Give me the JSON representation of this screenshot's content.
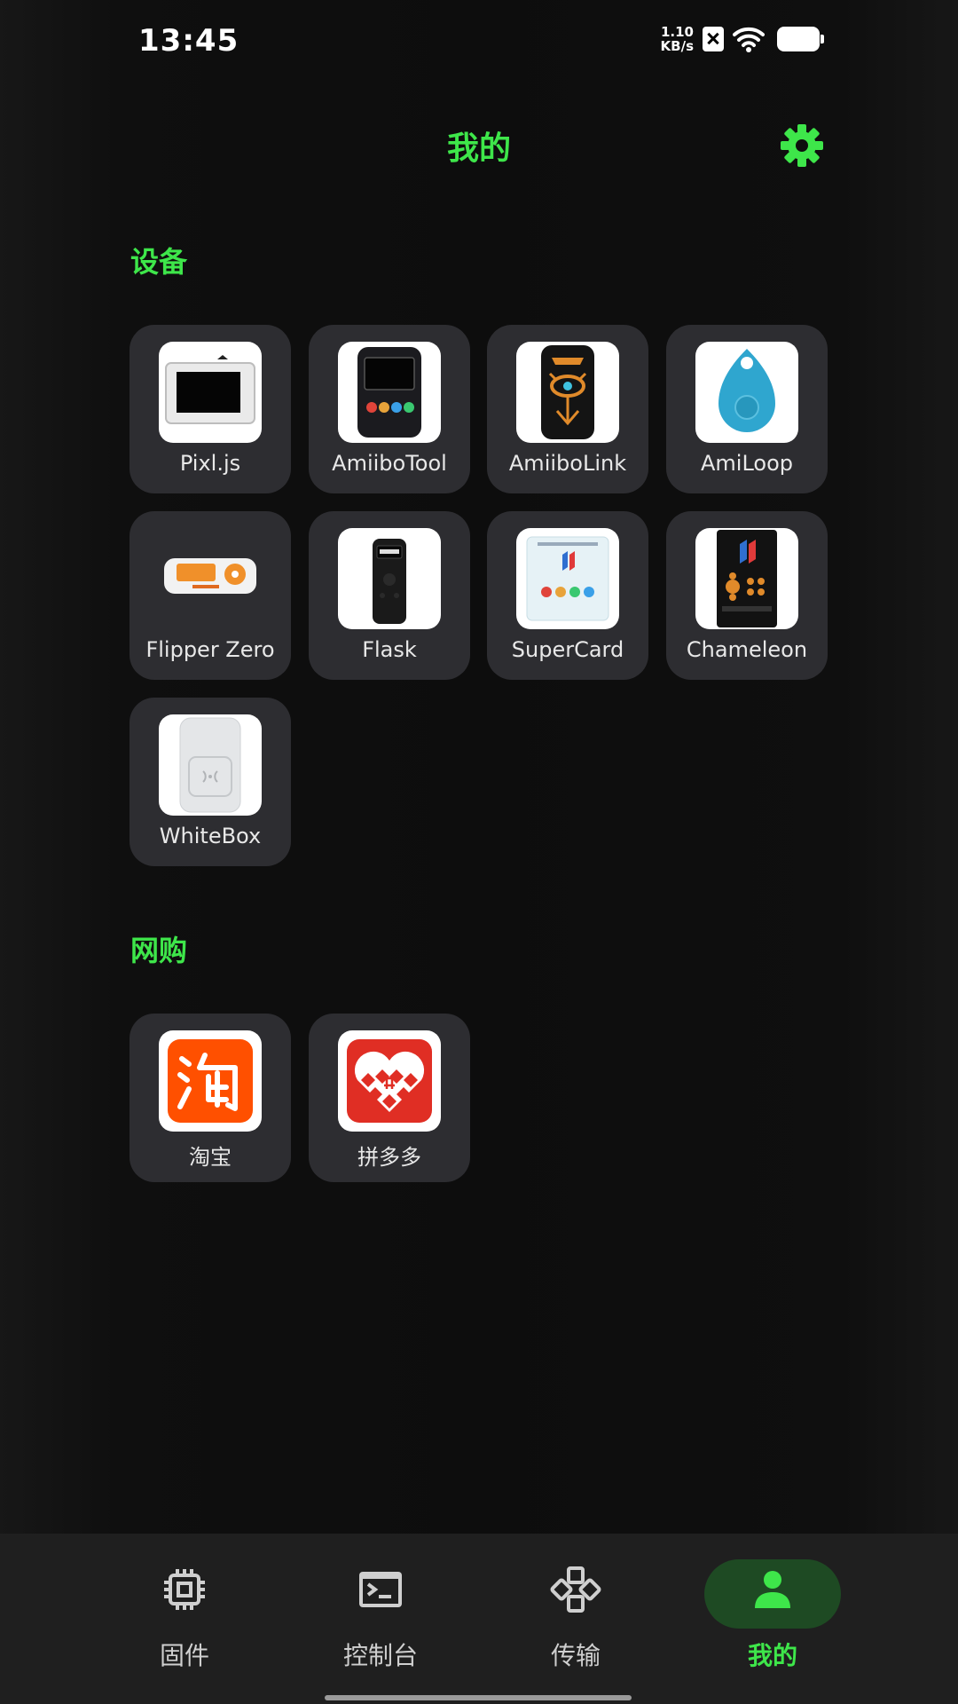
{
  "status_bar": {
    "time": "13:45",
    "net_speed_value": "1.10",
    "net_speed_unit": "KB/s"
  },
  "header": {
    "title": "我的"
  },
  "sections": {
    "devices": {
      "title": "设备",
      "items": [
        {
          "label": "Pixl.js"
        },
        {
          "label": "AmiiboTool"
        },
        {
          "label": "AmiiboLink"
        },
        {
          "label": "AmiLoop"
        },
        {
          "label": "Flipper Zero"
        },
        {
          "label": "Flask"
        },
        {
          "label": "SuperCard"
        },
        {
          "label": "Chameleon"
        },
        {
          "label": "WhiteBox"
        }
      ]
    },
    "shopping": {
      "title": "网购",
      "items": [
        {
          "label": "淘宝"
        },
        {
          "label": "拼多多"
        }
      ]
    }
  },
  "bottom_nav": {
    "items": [
      {
        "label": "固件",
        "icon": "chip-icon"
      },
      {
        "label": "控制台",
        "icon": "terminal-icon"
      },
      {
        "label": "传输",
        "icon": "transfer-icon"
      },
      {
        "label": "我的",
        "icon": "person-icon"
      }
    ],
    "active_index": 3
  },
  "colors": {
    "accent": "#3ee64a",
    "tile": "#2d2d31",
    "background": "#0e0e0e"
  }
}
